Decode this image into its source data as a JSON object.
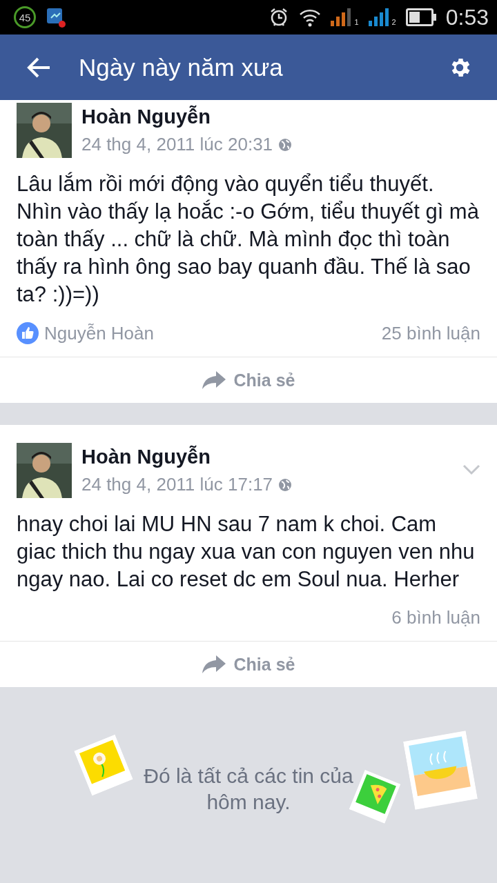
{
  "status_bar": {
    "battery_saver": "45",
    "sim_labels": [
      "1",
      "2"
    ],
    "time": "0:53"
  },
  "app_bar": {
    "title": "Ngày này năm xưa"
  },
  "posts": [
    {
      "author": "Hoàn Nguyễn",
      "time": "24 thg 4, 2011 lúc 20:31",
      "text": "Lâu lắm rồi mới động vào quyển tiểu thuyết. Nhìn vào thấy lạ hoắc :-o Gớm, tiểu thuyết gì mà toàn thấy ... chữ là chữ. Mà mình đọc thì toàn thấy ra hình ông sao bay quanh đầu. Thế là sao ta? :))=))",
      "likes": "Nguyễn Hoàn",
      "comments": "25 bình luận",
      "share": "Chia sẻ",
      "has_menu": false
    },
    {
      "author": "Hoàn Nguyễn",
      "time": "24 thg 4, 2011 lúc 17:17",
      "text": "hnay choi lai MU HN sau 7 nam k choi. Cam giac thich thu ngay xua van con nguyen ven nhu ngay nao. Lai co reset dc em Soul nua. Herher",
      "comments": "6 bình luận",
      "share": "Chia sẻ",
      "has_menu": true
    }
  ],
  "footer": {
    "message": "Đó là tất cả các tin của hôm nay."
  }
}
